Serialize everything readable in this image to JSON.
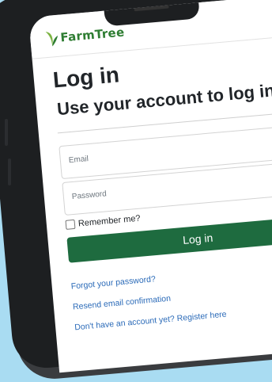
{
  "brand": {
    "name": "FarmTree"
  },
  "page": {
    "title": "Log in",
    "subtitle": "Use your account to log in"
  },
  "form": {
    "email_placeholder": "Email",
    "password_placeholder": "Password",
    "remember_label": "Remember me?",
    "submit_label": "Log in"
  },
  "links": {
    "forgot": "Forgot your password?",
    "resend": "Resend email confirmation",
    "register": "Don't have an account yet? Register here"
  },
  "colors": {
    "background": "#a9dcf2",
    "brand_green": "#2e7d32",
    "button": "#1e6b3f",
    "link": "#2a6ab8"
  }
}
